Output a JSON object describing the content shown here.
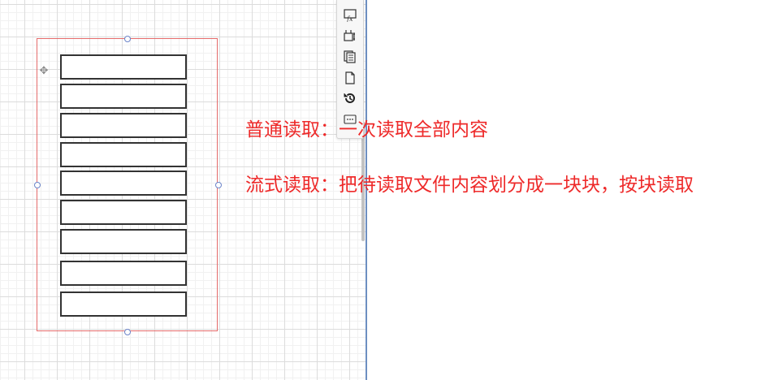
{
  "editor": {
    "toolbar": {
      "items": [
        {
          "icon": "edit-style-icon"
        },
        {
          "icon": "edit-geometry-icon"
        },
        {
          "icon": "copy-icon"
        },
        {
          "icon": "page-icon"
        },
        {
          "icon": "history-icon"
        },
        {
          "icon": "more-icon"
        }
      ]
    },
    "selection_color": "#e56b6b",
    "block_count": 9
  },
  "notes": {
    "normal_read": "普通读取：一次读取全部内容",
    "stream_read": "流式读取：把待读取文件内容划分成一块块，按块读取"
  },
  "colors": {
    "note_text": "#ee2a2a",
    "divider": "#6d8fc1"
  }
}
